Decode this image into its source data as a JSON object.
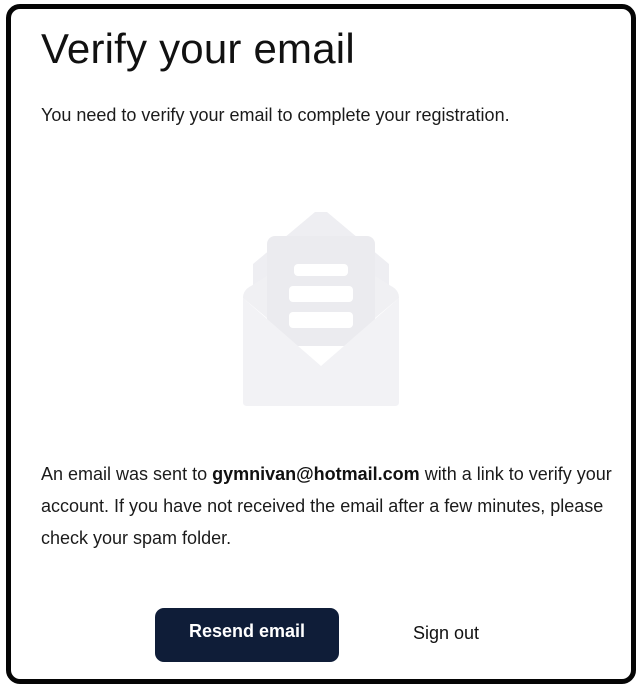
{
  "dialog": {
    "title": "Verify your email",
    "intro": "You need to verify your email to complete your registration.",
    "message_before": "An email was sent to ",
    "email": "gymnivan@hotmail.com",
    "message_after": " with a link to verify your account. If you have not received the email after a few minutes, please check your spam folder.",
    "illustration_icon": "envelope-open-icon",
    "resend_label": "Resend email",
    "signout_label": "Sign out"
  },
  "colors": {
    "primary_button": "#0f1d38",
    "illustration": "#f2f2f5",
    "text": "#1b1b1b"
  }
}
